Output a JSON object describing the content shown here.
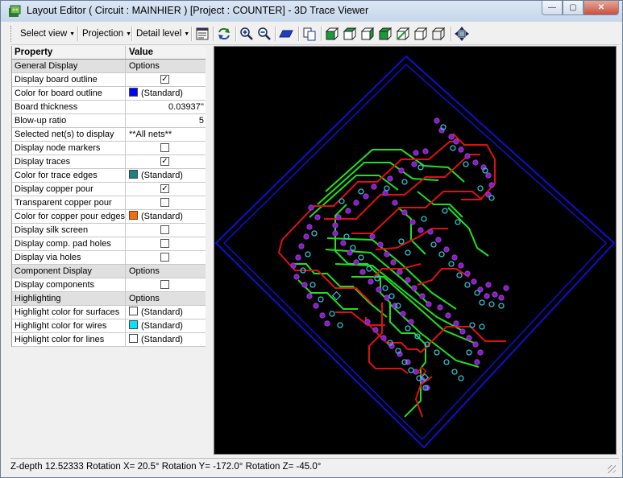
{
  "window": {
    "title": "Layout Editor ( Circuit : MAINHIER ) [Project : COUNTER] - 3D Trace Viewer",
    "min_label": "—",
    "max_label": "▢",
    "close_label": "✕"
  },
  "toolbar": {
    "select_view": "Select view",
    "projection": "Projection",
    "detail_level": "Detail level",
    "icons": [
      "properties-icon",
      "refresh-view-icon",
      "zoom-in-icon",
      "zoom-out-icon",
      "flat-board-icon",
      "copy-icon",
      "cube-view-1-icon",
      "cube-view-2-icon",
      "cube-view-3-icon",
      "cube-view-4-icon",
      "cube-view-5-icon",
      "cube-view-6-icon",
      "fit-view-icon"
    ]
  },
  "grid": {
    "header_property": "Property",
    "header_value": "Value",
    "rows": [
      {
        "type": "cat",
        "key": "General Display",
        "value": "Options"
      },
      {
        "type": "check",
        "key": "Display board outline",
        "checked": true
      },
      {
        "type": "color",
        "key": "Color for board outline",
        "value": "(Standard)",
        "color": "#0000ff"
      },
      {
        "type": "num",
        "key": "Board thickness",
        "value": "0.03937''"
      },
      {
        "type": "num",
        "key": "Blow-up ratio",
        "value": "5"
      },
      {
        "type": "text",
        "key": "Selected net(s) to display",
        "value": "**All nets**"
      },
      {
        "type": "check",
        "key": "Display node markers",
        "checked": false
      },
      {
        "type": "check",
        "key": "Display traces",
        "checked": true
      },
      {
        "type": "color",
        "key": "Color for trace edges",
        "value": "(Standard)",
        "color": "#1a8080"
      },
      {
        "type": "check",
        "key": "Display copper pour",
        "checked": true
      },
      {
        "type": "check",
        "key": "Transparent copper pour",
        "checked": false
      },
      {
        "type": "color",
        "key": "Color for copper pour edges",
        "value": "(Standard)",
        "color": "#ff6a00"
      },
      {
        "type": "check",
        "key": "Display silk screen",
        "checked": false
      },
      {
        "type": "check",
        "key": "Display comp. pad holes",
        "checked": false
      },
      {
        "type": "check",
        "key": "Display via holes",
        "checked": false
      },
      {
        "type": "cat",
        "key": "Component Display",
        "value": "Options"
      },
      {
        "type": "check",
        "key": "Display components",
        "checked": false
      },
      {
        "type": "cat",
        "key": "Highlighting",
        "value": "Options"
      },
      {
        "type": "color",
        "key": "Highlight color for surfaces",
        "value": "(Standard)",
        "color": "#ffffff"
      },
      {
        "type": "color",
        "key": "Highlight color for wires",
        "value": "(Standard)",
        "color": "#00e5ff"
      },
      {
        "type": "color",
        "key": "Highlight color for lines",
        "value": "(Standard)",
        "color": "#ffffff"
      }
    ]
  },
  "status": {
    "text": "Z-depth 12.52333  Rotation X= 20.5° Rotation Y= -172.0° Rotation Z= -45.0°"
  },
  "viewer_colors": {
    "board": "#1010d0",
    "trace_red": "#e01010",
    "trace_green": "#20e020",
    "pad": "#8020c0",
    "via": "#30c0d0"
  }
}
